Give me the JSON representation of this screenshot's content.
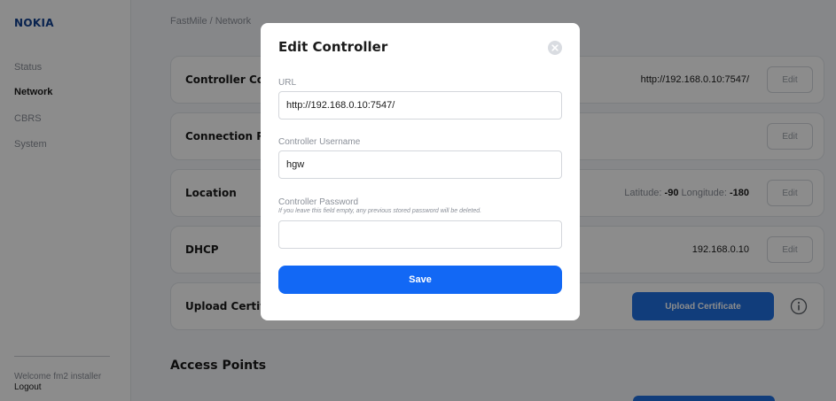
{
  "app": {
    "logo_text": "NOKIA",
    "breadcrumb": "FastMile / Network"
  },
  "sidebar": {
    "items": [
      {
        "label": "Status",
        "active": false
      },
      {
        "label": "Network",
        "active": true
      },
      {
        "label": "CBRS",
        "active": false
      },
      {
        "label": "System",
        "active": false
      }
    ],
    "welcome": "Welcome fm2 installer",
    "logout": "Logout"
  },
  "cards": {
    "controller": {
      "title": "Controller Configuration",
      "value": "http://192.168.0.10:7547/",
      "edit_label": "Edit"
    },
    "connection": {
      "title": "Connection Request",
      "edit_label": "Edit"
    },
    "location": {
      "title": "Location",
      "latitude_label": "Latitude:",
      "latitude": "-90",
      "longitude_label": "Longitude:",
      "longitude": "-180",
      "edit_label": "Edit"
    },
    "dhcp": {
      "title": "DHCP",
      "value": "192.168.0.10",
      "edit_label": "Edit"
    },
    "upload": {
      "title": "Upload Certificate",
      "button_label": "Upload Certificate"
    }
  },
  "access_points": {
    "title": "Access Points"
  },
  "modal": {
    "title": "Edit Controller",
    "url": {
      "label": "URL",
      "value": "http://192.168.0.10:7547/"
    },
    "username": {
      "label": "Controller Username",
      "value": "hgw"
    },
    "password": {
      "label": "Controller Password",
      "help": "If you leave this field empty, any previous stored password will be deleted.",
      "value": ""
    },
    "save_label": "Save"
  },
  "colors": {
    "brand": "#124191",
    "primary_button": "#1268f5",
    "overlay": "rgba(0,0,0,0.45)"
  },
  "icons": {
    "close": "close-icon",
    "info": "info-icon"
  }
}
